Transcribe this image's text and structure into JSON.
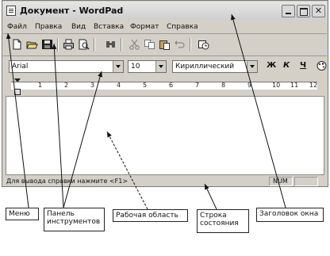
{
  "window": {
    "title": "Документ - WordPad",
    "close_glyph": "✕"
  },
  "menu": [
    "Файл",
    "Правка",
    "Вид",
    "Вставка",
    "Формат",
    "Справка"
  ],
  "toolbar": {
    "buttons": [
      "new-icon",
      "open-icon",
      "save-icon",
      "print-icon",
      "print-preview-icon",
      "find-icon",
      "cut-icon",
      "copy-icon",
      "paste-icon",
      "undo-icon",
      "insert-datetime-icon"
    ]
  },
  "format": {
    "font_name": "Arial",
    "font_size": "10",
    "script": "Кириллический",
    "bold": "Ж",
    "italic": "К",
    "underline": "Ч"
  },
  "ruler": {
    "numbers": [
      "1",
      "2",
      "3",
      "4",
      "5",
      "6",
      "7",
      "8",
      "9",
      "10",
      "11",
      "12"
    ]
  },
  "status": {
    "text": "Для вывода справки нажмите <F1>",
    "num": "NUM"
  },
  "callouts": {
    "menu": "Меню",
    "toolbar": "Панель инструментов",
    "workarea": "Рабочая область",
    "statusbar": "Строка состояния",
    "title": "Заголовок окна"
  }
}
